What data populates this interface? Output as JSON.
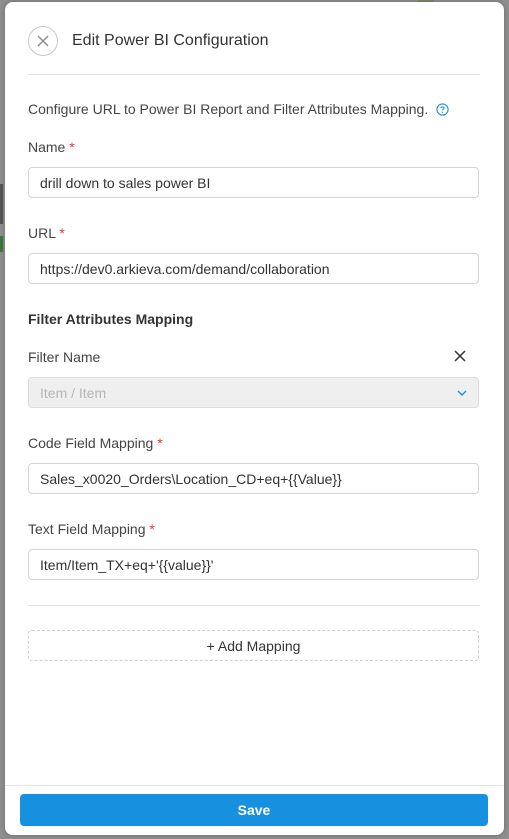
{
  "dialog": {
    "title": "Edit Power BI Configuration",
    "description": "Configure URL to Power BI Report and Filter Attributes Mapping."
  },
  "fields": {
    "name_label": "Name",
    "name_value": "drill down to sales power BI",
    "url_label": "URL",
    "url_value": "https://dev0.arkieva.com/demand/collaboration",
    "required_marker": "*"
  },
  "filter_section": {
    "title": "Filter Attributes Mapping",
    "filter_name_label": "Filter Name",
    "filter_name_placeholder": "Item / Item",
    "code_field_label": "Code Field Mapping",
    "code_field_value": "Sales_x0020_Orders\\Location_CD+eq+{{Value}}",
    "text_field_label": "Text Field Mapping",
    "text_field_value": "Item/Item_TX+eq+'{{value}}'"
  },
  "actions": {
    "add_mapping": "+ Add Mapping",
    "save": "Save"
  },
  "icons": {
    "close": "close-icon",
    "help": "help-circle-icon",
    "remove": "close-icon",
    "dropdown": "chevron-down-icon"
  },
  "colors": {
    "primary": "#1890e0",
    "required": "#e23a3a",
    "help_icon": "#1890e0"
  }
}
